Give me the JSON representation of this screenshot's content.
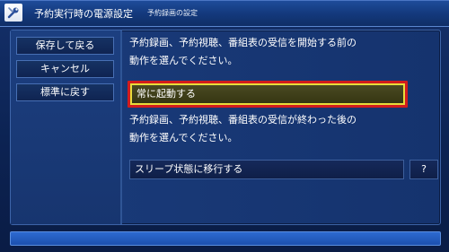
{
  "header": {
    "icon": "wrench-screwdriver-icon",
    "title": "予約実行時の電源設定",
    "subtitle": "予約録画の設定"
  },
  "sidebar": {
    "items": [
      {
        "label": "保存して戻る"
      },
      {
        "label": "キャンセル"
      },
      {
        "label": "標準に戻す"
      }
    ]
  },
  "content": {
    "before_description_line1": "予約録画、予約視聴、番組表の受信を開始する前の",
    "before_description_line2": "動作を選んでください。",
    "before_option_value": "常に起動する",
    "after_description_line1": "予約録画、予約視聴、番組表の受信が終わった後の",
    "after_description_line2": "動作を選んでください。",
    "after_option_value": "スリープ状態に移行する",
    "help_label": "?"
  },
  "colors": {
    "selection_border": "#d21c1c",
    "focus_border": "#e7dc3b",
    "background": "#14306a"
  }
}
